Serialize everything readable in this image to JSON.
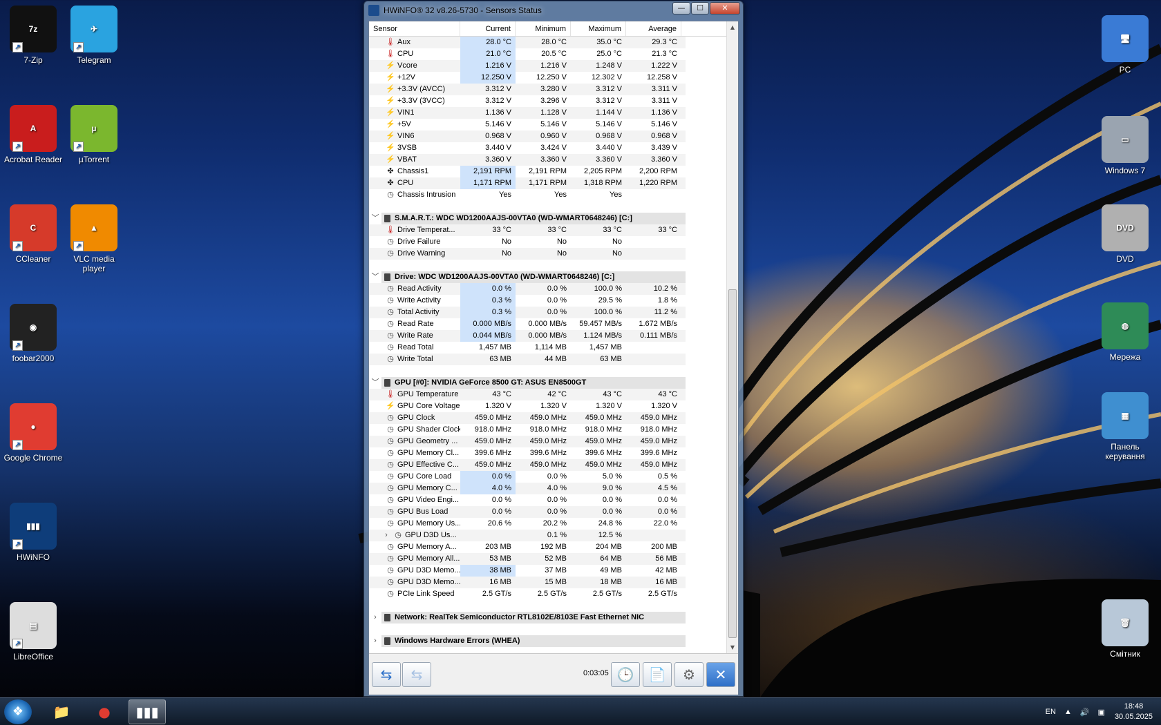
{
  "desktop": {
    "left_icons": [
      {
        "label": "7-Zip",
        "glyph": "7z",
        "color": "#111111"
      },
      {
        "label": "Telegram",
        "glyph": "✈",
        "color": "#2aa3e0"
      },
      {
        "label": "Acrobat Reader",
        "glyph": "A",
        "color": "#c91d1d"
      },
      {
        "label": "µTorrent",
        "glyph": "µ",
        "color": "#7bb72e"
      },
      {
        "label": "CCleaner",
        "glyph": "C",
        "color": "#d63a2a"
      },
      {
        "label": "VLC media player",
        "glyph": "▲",
        "color": "#f08a00"
      },
      {
        "label": "foobar2000",
        "glyph": "◉",
        "color": "#222222"
      },
      {
        "label": "Google Chrome",
        "glyph": "●",
        "color": "#e03c31"
      },
      {
        "label": "HWiNFO",
        "glyph": "▮▮▮",
        "color": "#0e3d7a"
      },
      {
        "label": "LibreOffice",
        "glyph": "▤",
        "color": "#dddddd"
      }
    ],
    "right_icons": [
      {
        "label": "PC",
        "glyph": "🖥",
        "color": "#3a7bd5"
      },
      {
        "label": "Windows 7",
        "glyph": "▭",
        "color": "#9aa4b0"
      },
      {
        "label": "DVD",
        "glyph": "DVD",
        "color": "#b0b0b0"
      },
      {
        "label": "Мережа",
        "glyph": "◍",
        "color": "#2e8b57"
      },
      {
        "label": "Панель керування",
        "glyph": "▦",
        "color": "#3f8fd0"
      },
      {
        "label": "Смітник",
        "glyph": "🗑",
        "color": "#b8c8d8"
      }
    ]
  },
  "window": {
    "title": "HWiNFO® 32 v8.26-5730 - Sensors Status",
    "controls": {
      "minimize": "—",
      "maximize": "☐",
      "close": "✕"
    },
    "columns": [
      "Sensor",
      "Current",
      "Minimum",
      "Maximum",
      "Average"
    ],
    "rows": [
      {
        "kind": "row",
        "icon": "temp",
        "name": "Aux",
        "cur": "28.0 °C",
        "min": "28.0 °C",
        "max": "35.0 °C",
        "avg": "29.3 °C",
        "hl": true
      },
      {
        "kind": "row",
        "icon": "temp",
        "name": "CPU",
        "cur": "21.0 °C",
        "min": "20.5 °C",
        "max": "25.0 °C",
        "avg": "21.3 °C",
        "hl": true
      },
      {
        "kind": "row",
        "icon": "volt",
        "name": "Vcore",
        "cur": "1.216 V",
        "min": "1.216 V",
        "max": "1.248 V",
        "avg": "1.222 V",
        "hl": true
      },
      {
        "kind": "row",
        "icon": "volt",
        "name": "+12V",
        "cur": "12.250 V",
        "min": "12.250 V",
        "max": "12.302 V",
        "avg": "12.258 V",
        "hl": true
      },
      {
        "kind": "row",
        "icon": "volt",
        "name": "+3.3V (AVCC)",
        "cur": "3.312 V",
        "min": "3.280 V",
        "max": "3.312 V",
        "avg": "3.311 V"
      },
      {
        "kind": "row",
        "icon": "volt",
        "name": "+3.3V (3VCC)",
        "cur": "3.312 V",
        "min": "3.296 V",
        "max": "3.312 V",
        "avg": "3.311 V"
      },
      {
        "kind": "row",
        "icon": "volt",
        "name": "VIN1",
        "cur": "1.136 V",
        "min": "1.128 V",
        "max": "1.144 V",
        "avg": "1.136 V"
      },
      {
        "kind": "row",
        "icon": "volt",
        "name": "+5V",
        "cur": "5.146 V",
        "min": "5.146 V",
        "max": "5.146 V",
        "avg": "5.146 V"
      },
      {
        "kind": "row",
        "icon": "volt",
        "name": "VIN6",
        "cur": "0.968 V",
        "min": "0.960 V",
        "max": "0.968 V",
        "avg": "0.968 V"
      },
      {
        "kind": "row",
        "icon": "volt",
        "name": "3VSB",
        "cur": "3.440 V",
        "min": "3.424 V",
        "max": "3.440 V",
        "avg": "3.439 V"
      },
      {
        "kind": "row",
        "icon": "volt",
        "name": "VBAT",
        "cur": "3.360 V",
        "min": "3.360 V",
        "max": "3.360 V",
        "avg": "3.360 V"
      },
      {
        "kind": "row",
        "icon": "fan",
        "name": "Chassis1",
        "cur": "2,191 RPM",
        "min": "2,191 RPM",
        "max": "2,205 RPM",
        "avg": "2,200 RPM",
        "hl": true
      },
      {
        "kind": "row",
        "icon": "fan",
        "name": "CPU",
        "cur": "1,171 RPM",
        "min": "1,171 RPM",
        "max": "1,318 RPM",
        "avg": "1,220 RPM",
        "hl": true
      },
      {
        "kind": "row",
        "icon": "clk",
        "name": "Chassis Intrusion",
        "cur": "Yes",
        "min": "Yes",
        "max": "Yes",
        "avg": ""
      },
      {
        "kind": "spacer"
      },
      {
        "kind": "group",
        "chev": "﹀",
        "label": "S.M.A.R.T.: WDC WD1200AAJS-00VTA0 (WD-WMART0648246) [C:]"
      },
      {
        "kind": "row",
        "icon": "temp",
        "name": "Drive Temperat...",
        "cur": "33 °C",
        "min": "33 °C",
        "max": "33 °C",
        "avg": "33 °C"
      },
      {
        "kind": "row",
        "icon": "clk",
        "name": "Drive Failure",
        "cur": "No",
        "min": "No",
        "max": "No",
        "avg": ""
      },
      {
        "kind": "row",
        "icon": "clk",
        "name": "Drive Warning",
        "cur": "No",
        "min": "No",
        "max": "No",
        "avg": ""
      },
      {
        "kind": "spacer"
      },
      {
        "kind": "group",
        "chev": "﹀",
        "label": "Drive: WDC WD1200AAJS-00VTA0 (WD-WMART0648246) [C:]"
      },
      {
        "kind": "row",
        "icon": "clk",
        "name": "Read Activity",
        "cur": "0.0 %",
        "min": "0.0 %",
        "max": "100.0 %",
        "avg": "10.2 %",
        "hl": true
      },
      {
        "kind": "row",
        "icon": "clk",
        "name": "Write Activity",
        "cur": "0.3 %",
        "min": "0.0 %",
        "max": "29.5 %",
        "avg": "1.8 %",
        "hl": true
      },
      {
        "kind": "row",
        "icon": "clk",
        "name": "Total Activity",
        "cur": "0.3 %",
        "min": "0.0 %",
        "max": "100.0 %",
        "avg": "11.2 %",
        "hl": true
      },
      {
        "kind": "row",
        "icon": "clk",
        "name": "Read Rate",
        "cur": "0.000 MB/s",
        "min": "0.000 MB/s",
        "max": "59.457 MB/s",
        "avg": "1.672 MB/s",
        "hl": true
      },
      {
        "kind": "row",
        "icon": "clk",
        "name": "Write Rate",
        "cur": "0.044 MB/s",
        "min": "0.000 MB/s",
        "max": "1.124 MB/s",
        "avg": "0.111 MB/s",
        "hl": true
      },
      {
        "kind": "row",
        "icon": "clk",
        "name": "Read Total",
        "cur": "1,457 MB",
        "min": "1,114 MB",
        "max": "1,457 MB",
        "avg": ""
      },
      {
        "kind": "row",
        "icon": "clk",
        "name": "Write Total",
        "cur": "63 MB",
        "min": "44 MB",
        "max": "63 MB",
        "avg": ""
      },
      {
        "kind": "spacer"
      },
      {
        "kind": "group",
        "chev": "﹀",
        "label": "GPU [#0]: NVIDIA GeForce 8500 GT: ASUS EN8500GT"
      },
      {
        "kind": "row",
        "icon": "temp",
        "name": "GPU Temperature",
        "cur": "43 °C",
        "min": "42 °C",
        "max": "43 °C",
        "avg": "43 °C"
      },
      {
        "kind": "row",
        "icon": "volt",
        "name": "GPU Core Voltage",
        "cur": "1.320 V",
        "min": "1.320 V",
        "max": "1.320 V",
        "avg": "1.320 V"
      },
      {
        "kind": "row",
        "icon": "clk",
        "name": "GPU Clock",
        "cur": "459.0 MHz",
        "min": "459.0 MHz",
        "max": "459.0 MHz",
        "avg": "459.0 MHz"
      },
      {
        "kind": "row",
        "icon": "clk",
        "name": "GPU Shader Clock",
        "cur": "918.0 MHz",
        "min": "918.0 MHz",
        "max": "918.0 MHz",
        "avg": "918.0 MHz"
      },
      {
        "kind": "row",
        "icon": "clk",
        "name": "GPU Geometry ...",
        "cur": "459.0 MHz",
        "min": "459.0 MHz",
        "max": "459.0 MHz",
        "avg": "459.0 MHz"
      },
      {
        "kind": "row",
        "icon": "clk",
        "name": "GPU Memory Cl...",
        "cur": "399.6 MHz",
        "min": "399.6 MHz",
        "max": "399.6 MHz",
        "avg": "399.6 MHz"
      },
      {
        "kind": "row",
        "icon": "clk",
        "name": "GPU Effective C...",
        "cur": "459.0 MHz",
        "min": "459.0 MHz",
        "max": "459.0 MHz",
        "avg": "459.0 MHz"
      },
      {
        "kind": "row",
        "icon": "clk",
        "name": "GPU Core Load",
        "cur": "0.0 %",
        "min": "0.0 %",
        "max": "5.0 %",
        "avg": "0.5 %",
        "hl": true
      },
      {
        "kind": "row",
        "icon": "clk",
        "name": "GPU Memory C...",
        "cur": "4.0 %",
        "min": "4.0 %",
        "max": "9.0 %",
        "avg": "4.5 %",
        "hl": true
      },
      {
        "kind": "row",
        "icon": "clk",
        "name": "GPU Video Engi...",
        "cur": "0.0 %",
        "min": "0.0 %",
        "max": "0.0 %",
        "avg": "0.0 %"
      },
      {
        "kind": "row",
        "icon": "clk",
        "name": "GPU Bus Load",
        "cur": "0.0 %",
        "min": "0.0 %",
        "max": "0.0 %",
        "avg": "0.0 %"
      },
      {
        "kind": "row",
        "icon": "clk",
        "name": "GPU Memory Us...",
        "cur": "20.6 %",
        "min": "20.2 %",
        "max": "24.8 %",
        "avg": "22.0 %"
      },
      {
        "kind": "row",
        "icon": "clk",
        "expand": "›",
        "name": "GPU D3D Us...",
        "cur": "",
        "min": "0.1 %",
        "max": "12.5 %",
        "avg": ""
      },
      {
        "kind": "row",
        "icon": "clk",
        "name": "GPU Memory A...",
        "cur": "203 MB",
        "min": "192 MB",
        "max": "204 MB",
        "avg": "200 MB"
      },
      {
        "kind": "row",
        "icon": "clk",
        "name": "GPU Memory All...",
        "cur": "53 MB",
        "min": "52 MB",
        "max": "64 MB",
        "avg": "56 MB"
      },
      {
        "kind": "row",
        "icon": "clk",
        "name": "GPU D3D Memo...",
        "cur": "38 MB",
        "min": "37 MB",
        "max": "49 MB",
        "avg": "42 MB",
        "hl": true
      },
      {
        "kind": "row",
        "icon": "clk",
        "name": "GPU D3D Memo...",
        "cur": "16 MB",
        "min": "15 MB",
        "max": "18 MB",
        "avg": "16 MB"
      },
      {
        "kind": "row",
        "icon": "clk",
        "name": "PCIe Link Speed",
        "cur": "2.5 GT/s",
        "min": "2.5 GT/s",
        "max": "2.5 GT/s",
        "avg": "2.5 GT/s"
      },
      {
        "kind": "spacer"
      },
      {
        "kind": "group",
        "chev": "›",
        "label": "Network: RealTek Semiconductor RTL8102E/8103E Fast Ethernet NIC"
      },
      {
        "kind": "spacer"
      },
      {
        "kind": "group",
        "chev": "›",
        "label": "Windows Hardware Errors (WHEA)"
      }
    ],
    "toolbar": {
      "timer": "0:03:05",
      "nav_back_glyph": "⇆",
      "nav_fwd_glyph": "⇆",
      "clock_glyph": "🕒",
      "report_glyph": "📄",
      "settings_glyph": "⚙",
      "close_glyph": "✕"
    }
  },
  "taskbar": {
    "start_glyph": "❖",
    "items": [
      {
        "name": "explorer",
        "glyph": "📁",
        "active": false
      },
      {
        "name": "chrome",
        "glyph": "●",
        "active": false
      },
      {
        "name": "hwinfo",
        "glyph": "▮▮▮",
        "active": true
      }
    ],
    "language": "EN",
    "time": "18:48",
    "date": "30.05.2025"
  }
}
